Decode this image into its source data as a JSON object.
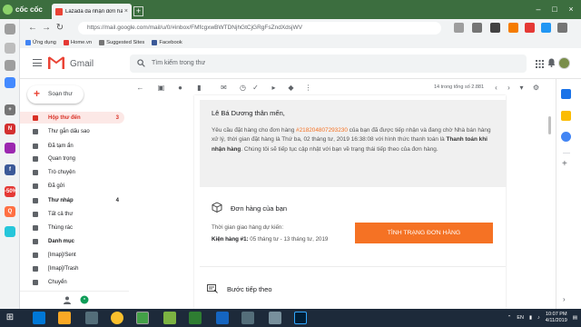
{
  "browser": {
    "name": "cốc cốc",
    "tab_title": "Lazada đã nhận đơn hàng",
    "url": "https://mail.google.com/mail/u/0/#inbox/FMfcgxwBWTDNjhGtCjGRgFsZndXdsjWV",
    "bookmarks": [
      {
        "label": "Ứng dụng",
        "color": "#4285f4"
      },
      {
        "label": "Home.vn",
        "color": "#e53935"
      },
      {
        "label": "Suggested Sites",
        "color": "#757575"
      },
      {
        "label": "Facebook",
        "color": "#3b5998"
      }
    ]
  },
  "gmail": {
    "logo_text": "Gmail",
    "search_placeholder": "Tìm kiếm trong thư",
    "compose_label": "Soạn thư",
    "nav": [
      {
        "label": "Hộp thư đến",
        "count": "3",
        "active": true,
        "bold": false
      },
      {
        "label": "Thư gắn dấu sao",
        "count": "",
        "active": false,
        "bold": false
      },
      {
        "label": "Đã tạm ẩn",
        "count": "",
        "active": false,
        "bold": false
      },
      {
        "label": "Quan trọng",
        "count": "",
        "active": false,
        "bold": false
      },
      {
        "label": "Trò chuyện",
        "count": "",
        "active": false,
        "bold": false
      },
      {
        "label": "Đã gửi",
        "count": "",
        "active": false,
        "bold": false
      },
      {
        "label": "Thư nháp",
        "count": "4",
        "active": false,
        "bold": true
      },
      {
        "label": "Tất cả thư",
        "count": "",
        "active": false,
        "bold": false
      },
      {
        "label": "Thùng rác",
        "count": "",
        "active": false,
        "bold": false
      },
      {
        "label": "Danh mục",
        "count": "",
        "active": false,
        "bold": true
      },
      {
        "label": "[Imap]/Sent",
        "count": "",
        "active": false,
        "bold": false
      },
      {
        "label": "[Imap]/Trash",
        "count": "",
        "active": false,
        "bold": false
      },
      {
        "label": "Chuyển",
        "count": "",
        "active": false,
        "bold": false
      }
    ],
    "pager": "14 trong tổng số 2.881"
  },
  "email": {
    "greeting": "Lê Bá Dương thân mến,",
    "body_pre": "Yêu cầu đặt hàng cho đơn hàng ",
    "order_number": "#218204807293230",
    "body_mid": " của bạn đã được tiếp nhận và đang chờ Nhà bán hàng xử lý, thời gian đặt hàng là Thứ ba, 02 tháng tư, 2019 16:38:08 với hình thức thanh toán là ",
    "payment_method": "Thanh toán khi nhận hàng",
    "body_post": ". Chúng tôi sẽ tiếp tục cập nhật với bạn về trạng thái tiếp theo của đơn hàng.",
    "section_title": "Đơn hàng của bạn",
    "eta_label": "Thời gian giao hàng dự kiến:",
    "package_label": "Kiện hàng #1:",
    "package_eta": " 05 tháng tư - 13 tháng tư, 2019",
    "status_button": "TÌNH TRẠNG ĐƠN HÀNG",
    "next_section": "Bước tiếp theo"
  },
  "taskbar": {
    "language": "EN",
    "time": "10:07 PM",
    "date": "4/11/2019"
  },
  "colors": {
    "accent": "#f57224",
    "gmail_red": "#d93025",
    "browser_green": "#3c6e3f"
  }
}
